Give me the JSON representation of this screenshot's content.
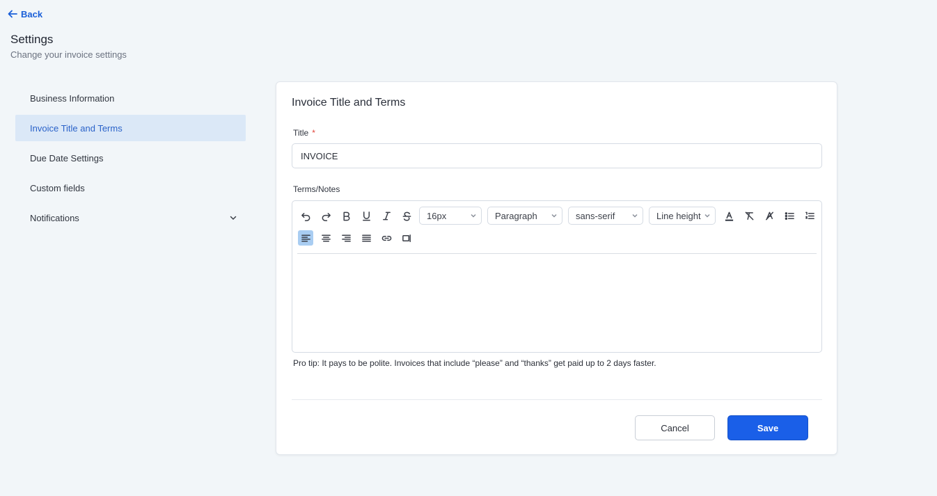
{
  "header": {
    "back_label": "Back",
    "title": "Settings",
    "subtitle": "Change your invoice settings"
  },
  "sidebar": {
    "items": [
      {
        "label": "Business Information"
      },
      {
        "label": "Invoice Title and Terms",
        "active": true
      },
      {
        "label": "Due Date Settings"
      },
      {
        "label": "Custom fields"
      },
      {
        "label": "Notifications",
        "icon": "chevron-down-icon"
      }
    ]
  },
  "card": {
    "title": "Invoice Title and Terms",
    "title_field": {
      "label": "Title",
      "required_mark": "*",
      "value": "INVOICE"
    },
    "terms_field": {
      "label": "Terms/Notes"
    },
    "toolbar": {
      "font_size": "16px",
      "block_format": "Paragraph",
      "font_family": "sans-serif",
      "line_height": "Line height",
      "buttons": [
        "undo-icon",
        "redo-icon",
        "bold-icon",
        "underline-icon",
        "italic-icon",
        "strikethrough-icon",
        "font-color-icon",
        "clear-format-icon",
        "highlight-icon",
        "bullet-list-icon",
        "numbered-list-icon",
        "align-left-icon",
        "align-center-icon",
        "align-right-icon",
        "align-justify-icon",
        "link-icon",
        "embed-icon"
      ]
    },
    "pro_tip": "Pro tip: It pays to be polite. Invoices that include “please” and “thanks” get paid up to 2 days faster.",
    "cancel_label": "Cancel",
    "save_label": "Save"
  },
  "colors": {
    "accent": "#1a5fe8",
    "active_sidebar_bg": "#dbe8f7",
    "page_bg": "#f2f6f9"
  }
}
